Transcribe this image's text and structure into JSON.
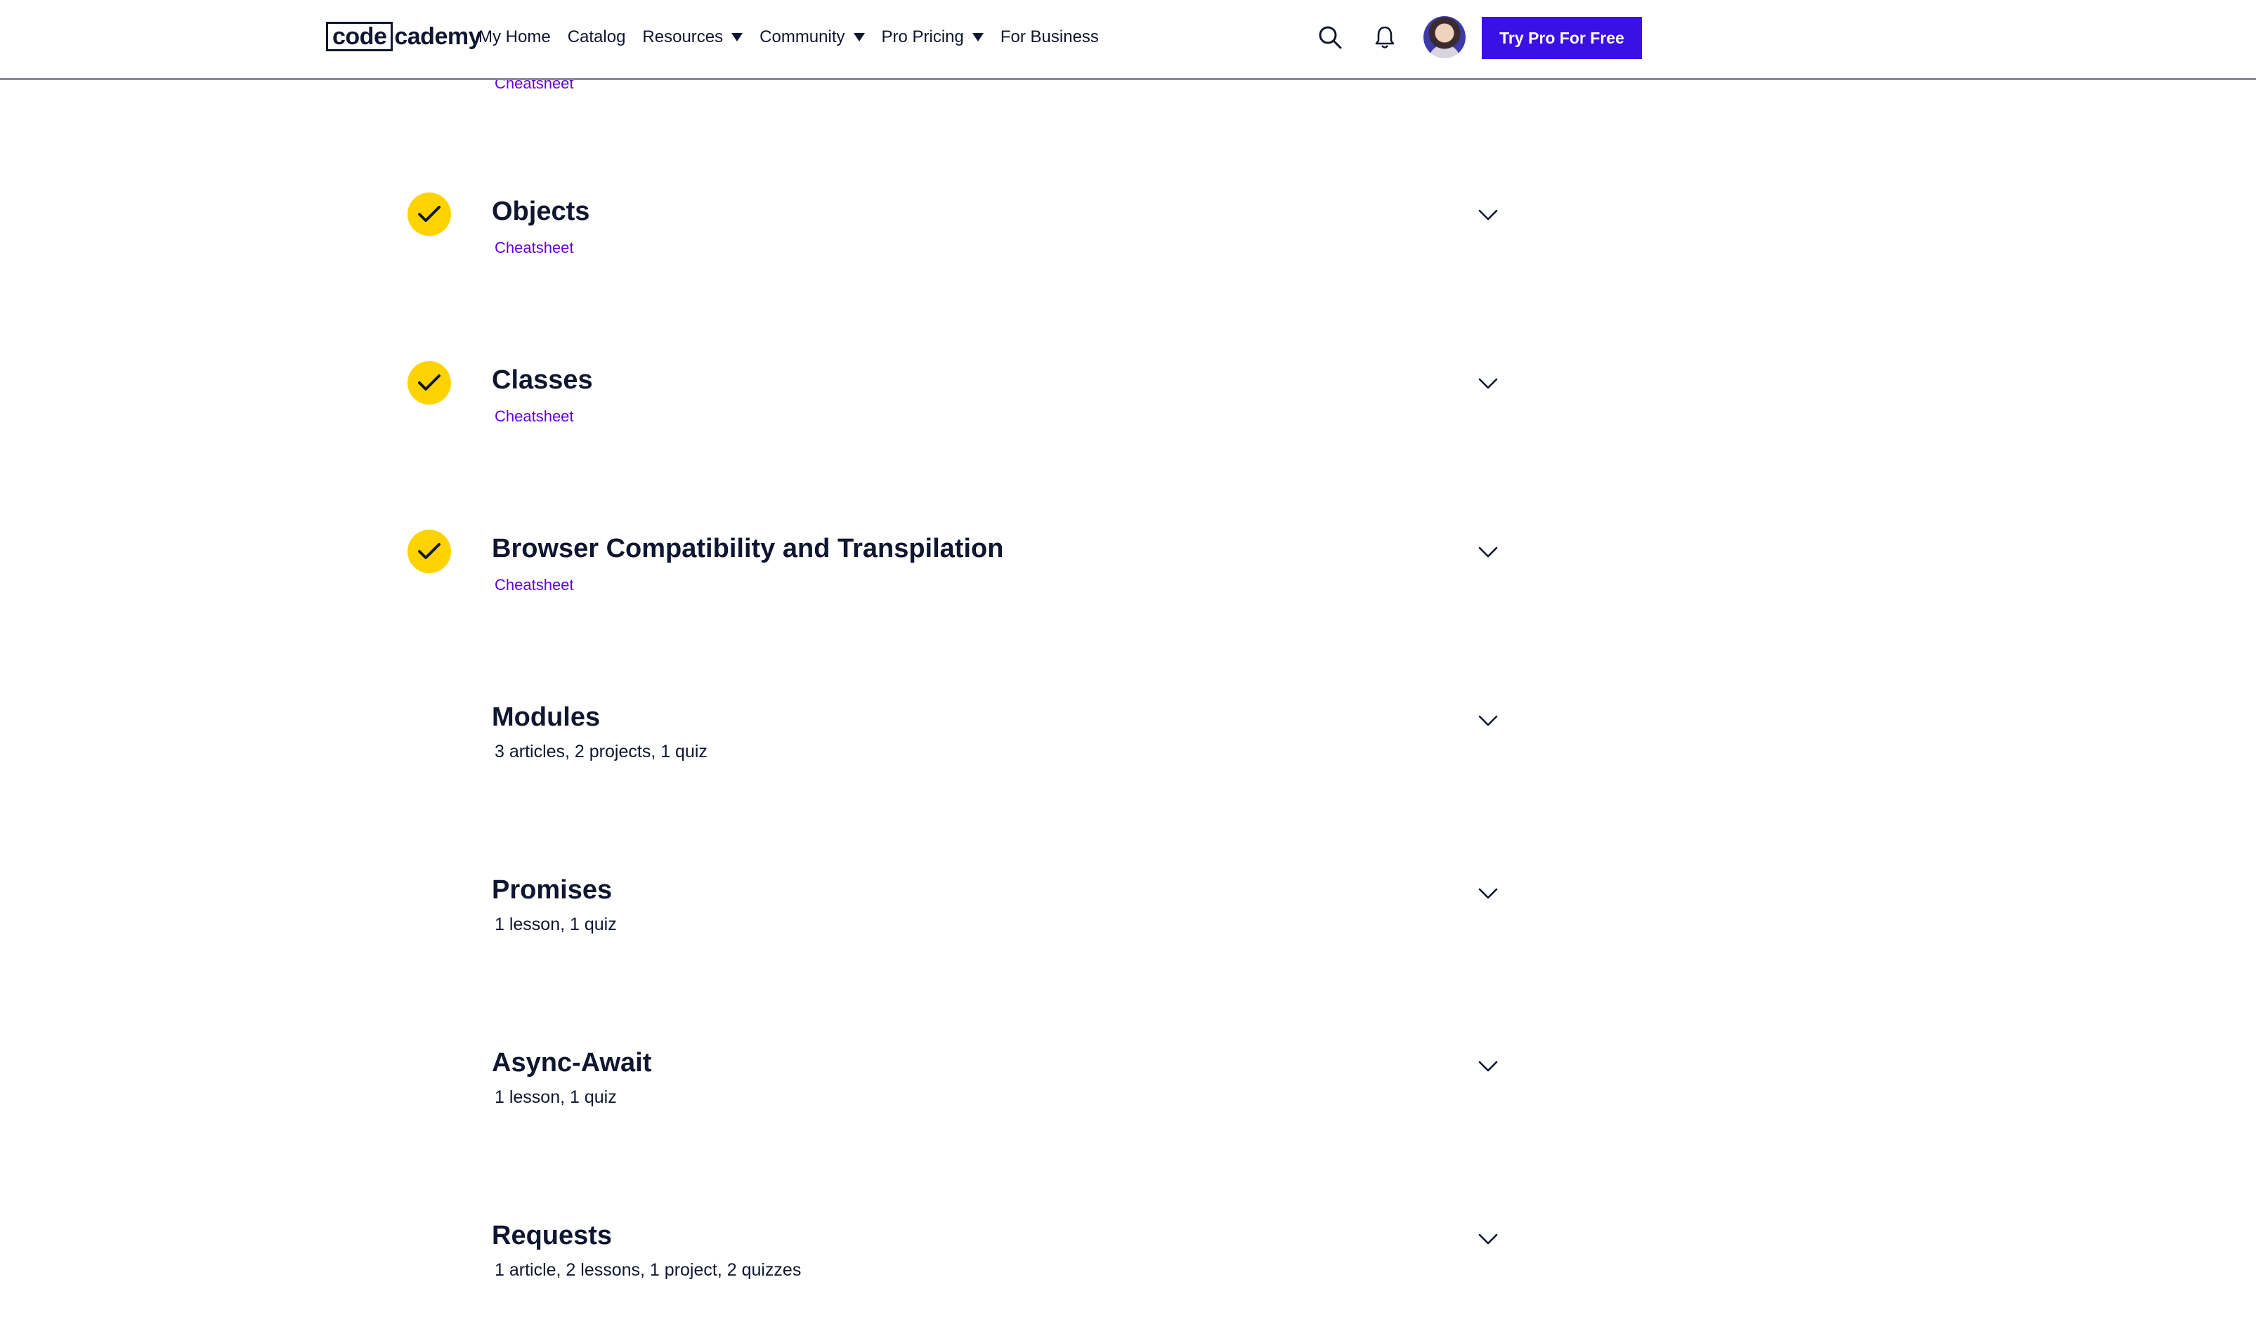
{
  "header": {
    "logo": {
      "boxed": "code",
      "rest": "cademy"
    },
    "nav": [
      {
        "label": "My Home",
        "dropdown": false
      },
      {
        "label": "Catalog",
        "dropdown": false
      },
      {
        "label": "Resources",
        "dropdown": true
      },
      {
        "label": "Community",
        "dropdown": true
      },
      {
        "label": "Pro Pricing",
        "dropdown": true
      },
      {
        "label": "For Business",
        "dropdown": false
      }
    ],
    "icons": [
      "search-icon",
      "bell-icon"
    ],
    "cta_label": "Try Pro For Free",
    "cta_color": "#3a10e5"
  },
  "partial_cheatsheet": "Cheatsheet",
  "modules": [
    {
      "title": "Objects",
      "completed": true,
      "link": "Cheatsheet"
    },
    {
      "title": "Classes",
      "completed": true,
      "link": "Cheatsheet"
    },
    {
      "title": "Browser Compatibility and Transpilation",
      "completed": true,
      "link": "Cheatsheet"
    },
    {
      "title": "Modules",
      "completed": false,
      "subtitle": "3 articles, 2 projects, 1 quiz"
    },
    {
      "title": "Promises",
      "completed": false,
      "subtitle": "1 lesson, 1 quiz"
    },
    {
      "title": "Async-Await",
      "completed": false,
      "subtitle": "1 lesson, 1 quiz"
    },
    {
      "title": "Requests",
      "completed": false,
      "subtitle": "1 article, 2 lessons, 1 project, 2 quizzes"
    }
  ],
  "colors": {
    "check": "#ffd300",
    "link": "#6400e4",
    "text": "#10162f"
  }
}
